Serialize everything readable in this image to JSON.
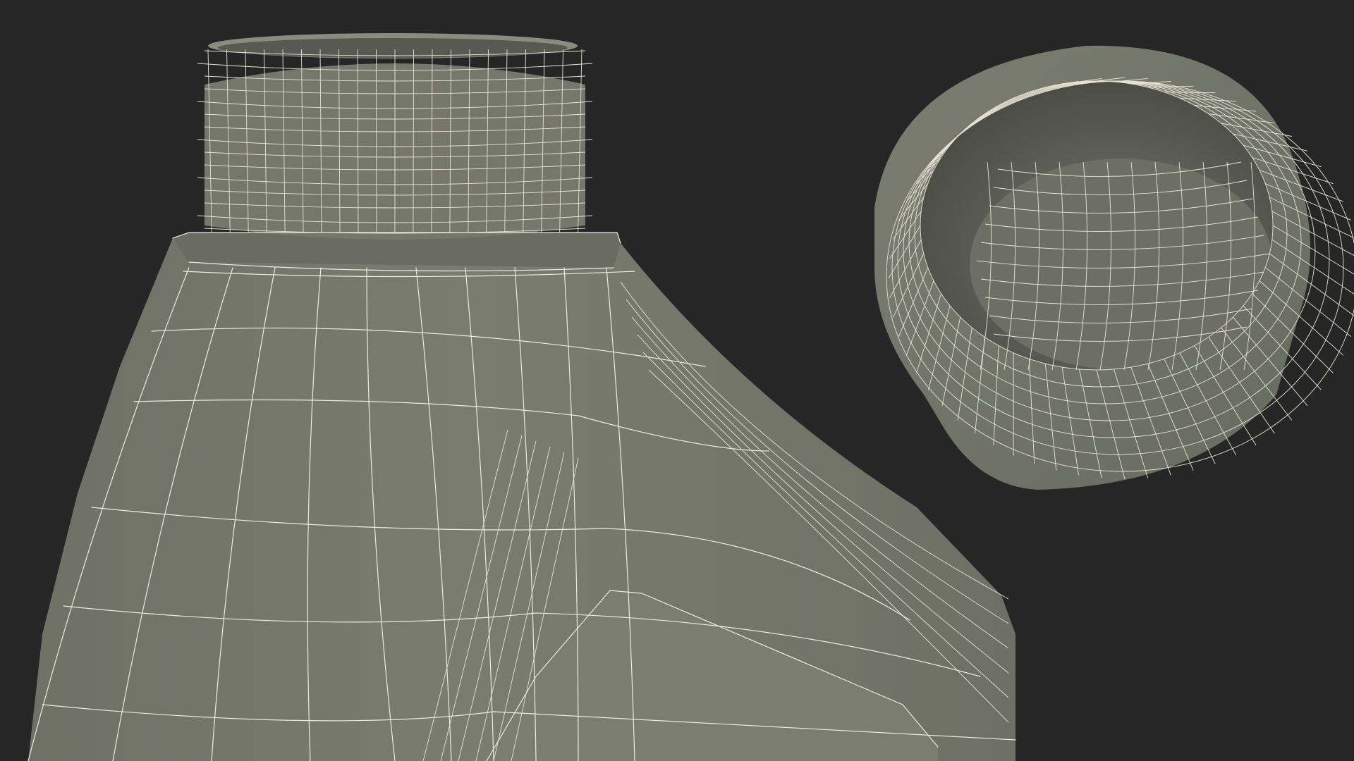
{
  "scene": {
    "background_color": "#262626",
    "mesh_fill_color": "#787a6d",
    "mesh_shadow_color": "#5e6056",
    "wire_color": "#ecebdf"
  },
  "objects": [
    {
      "name": "bottle-body",
      "kind": "wireframe-mesh"
    },
    {
      "name": "bottle-cap",
      "kind": "wireframe-mesh"
    }
  ]
}
